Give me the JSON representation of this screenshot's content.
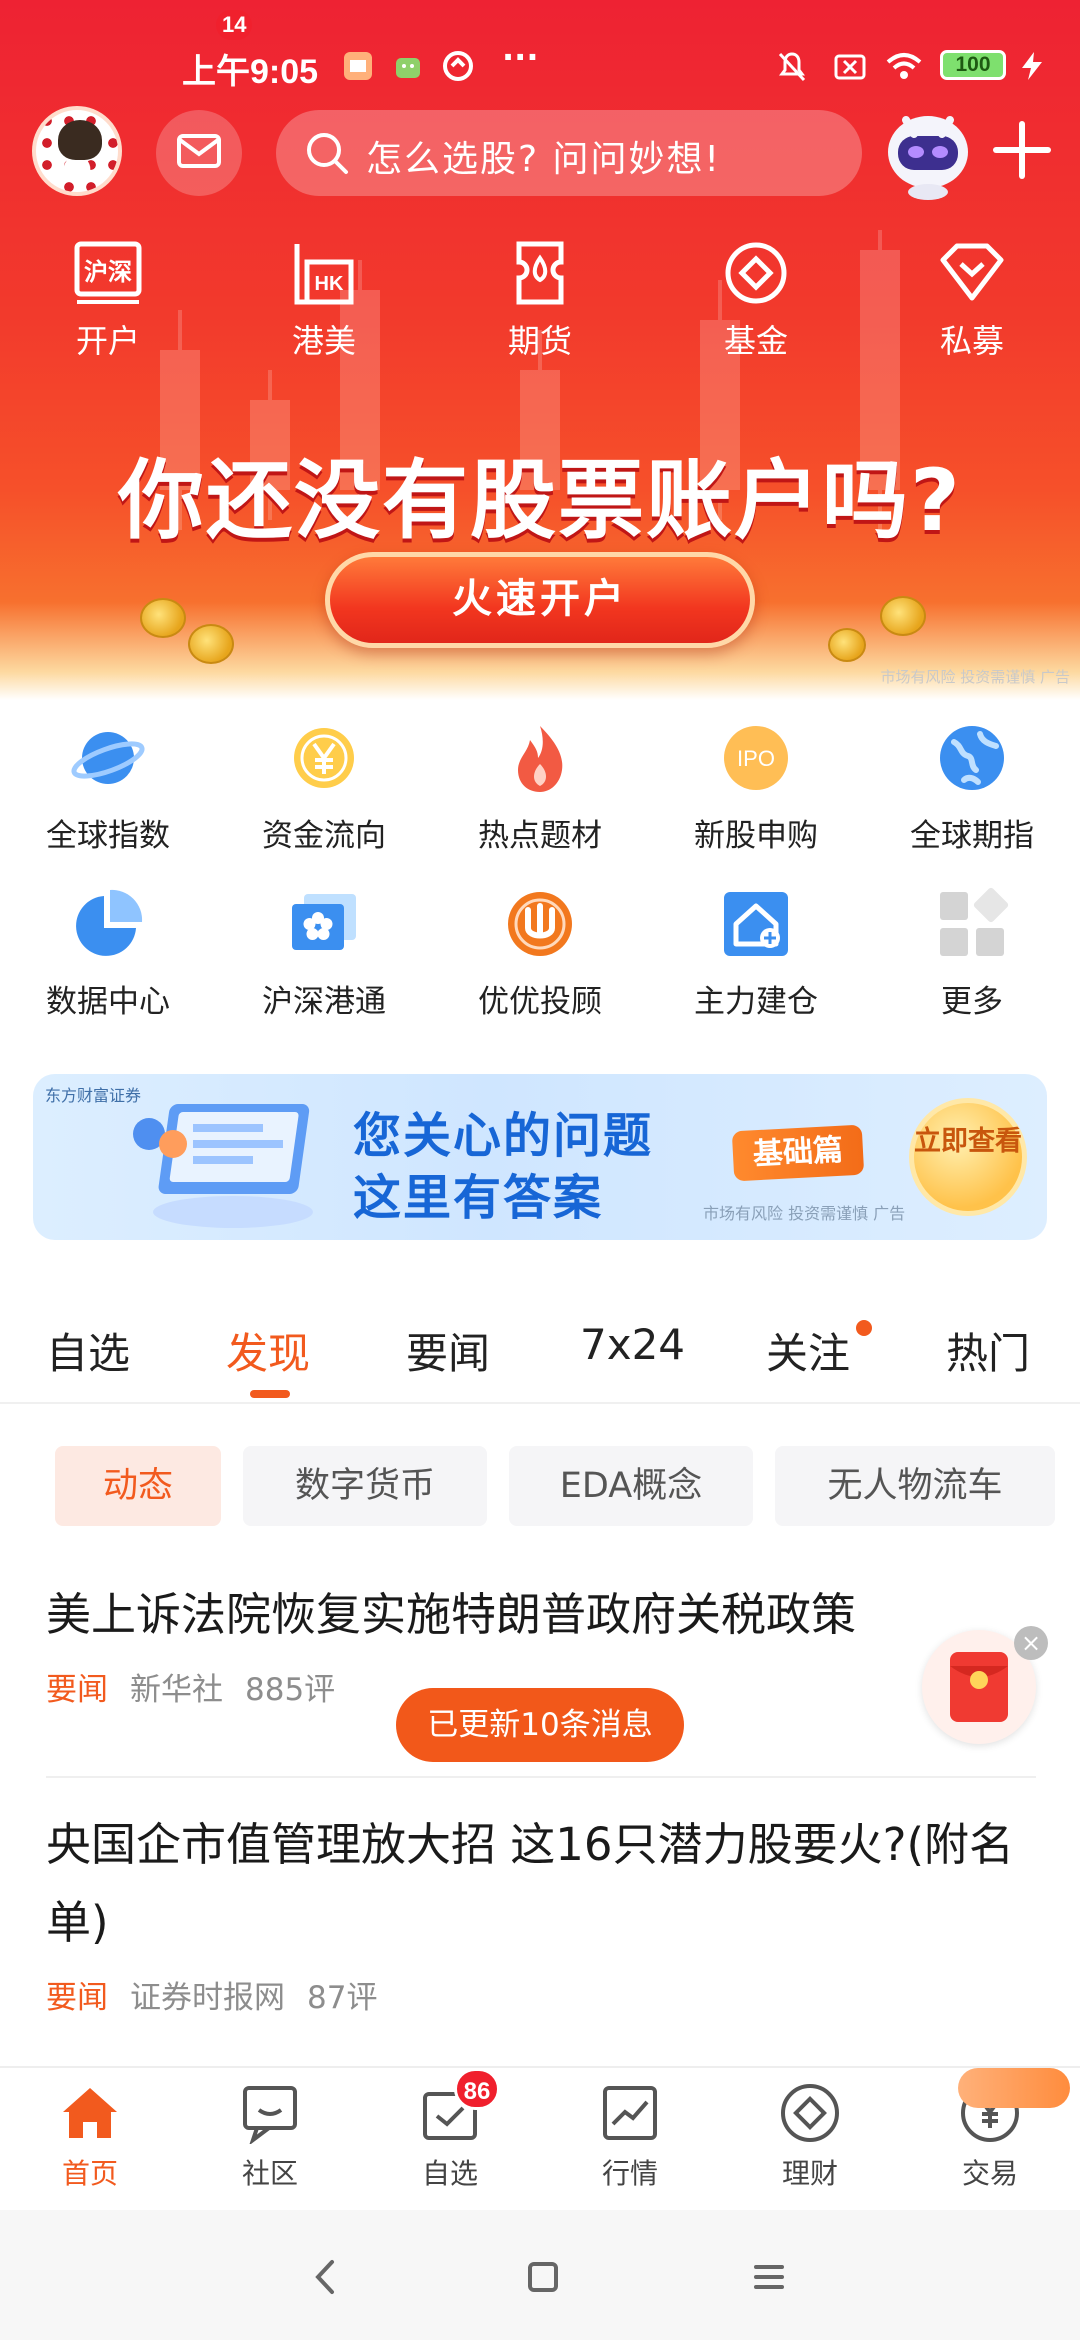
{
  "status_bar": {
    "time": "上午9:05",
    "battery": "100",
    "more_dots": "···"
  },
  "header": {
    "mail_badge": "14",
    "search_placeholder": "怎么选股? 问问妙想!"
  },
  "quick_nav": [
    {
      "label": "开户",
      "icon": "hushen-account-icon"
    },
    {
      "label": "港美",
      "icon": "hk-us-stock-icon"
    },
    {
      "label": "期货",
      "icon": "futures-icon"
    },
    {
      "label": "基金",
      "icon": "fund-icon"
    },
    {
      "label": "私募",
      "icon": "private-fund-icon"
    }
  ],
  "quick_nav_icon_text": {
    "account": "沪深",
    "hk": "HK"
  },
  "banner": {
    "title": "你还没有股票账户吗?",
    "button": "火速开户",
    "risk_note": "市场有风险 投资需谨慎 广告"
  },
  "feature_grid": [
    {
      "label": "全球指数",
      "icon": "planet-icon"
    },
    {
      "label": "资金流向",
      "icon": "yen-coin-icon"
    },
    {
      "label": "热点题材",
      "icon": "flame-icon"
    },
    {
      "label": "新股申购",
      "icon": "ipo-icon"
    },
    {
      "label": "全球期指",
      "icon": "globe-icon"
    },
    {
      "label": "数据中心",
      "icon": "pie-chart-icon"
    },
    {
      "label": "沪深港通",
      "icon": "hk-connect-icon"
    },
    {
      "label": "优优投顾",
      "icon": "uu-advisor-icon"
    },
    {
      "label": "主力建仓",
      "icon": "house-plus-icon"
    },
    {
      "label": "更多",
      "icon": "more-grid-icon"
    }
  ],
  "ipo_icon_text": "IPO",
  "ad_banner": {
    "logo": "东方财富证券",
    "line1": "您关心的问题",
    "line2": "这里有答案",
    "tag": "基础篇",
    "button": "立即查看",
    "note": "市场有风险 投资需谨慎 广告"
  },
  "tabs": [
    "自选",
    "发现",
    "要闻",
    "7x24",
    "关注",
    "热门"
  ],
  "active_tab": "发现",
  "chips": [
    "动态",
    "数字货币",
    "EDA概念",
    "无人物流车"
  ],
  "news": [
    {
      "title": "美上诉法院恢复实施特朗普政府关税政策",
      "tag": "要闻",
      "source": "新华社",
      "comments": "885评"
    },
    {
      "title": "央国企市值管理放大招 这16只潜力股要火?(附名单)",
      "tag": "要闻",
      "source": "证券时报网",
      "comments": "87评"
    }
  ],
  "update_pill": "已更新10条消息",
  "bottom_nav": [
    {
      "label": "首页",
      "icon": "home-icon"
    },
    {
      "label": "社区",
      "icon": "community-icon"
    },
    {
      "label": "自选",
      "icon": "watchlist-icon"
    },
    {
      "label": "行情",
      "icon": "market-icon"
    },
    {
      "label": "理财",
      "icon": "wealth-icon"
    },
    {
      "label": "交易",
      "icon": "trade-icon"
    }
  ],
  "watchlist_badge": "86",
  "colors": {
    "brand_red": "#ee2233",
    "accent_orange": "#f25a1e",
    "ad_blue": "#1766d6"
  }
}
